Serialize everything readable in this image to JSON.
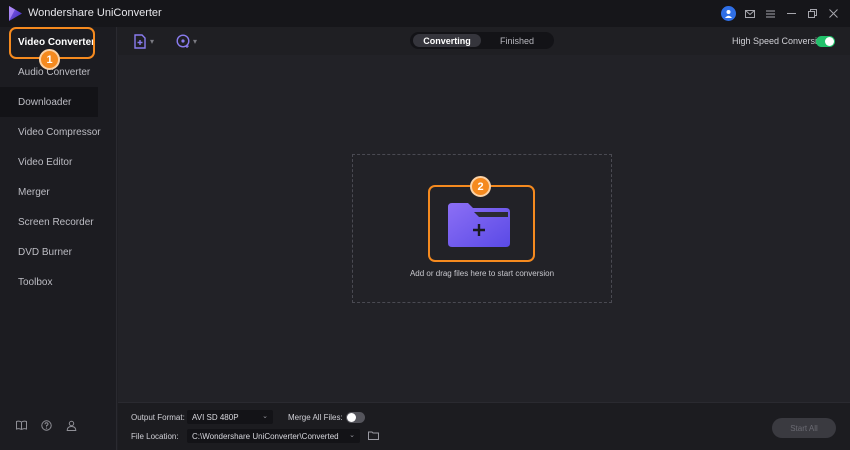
{
  "window": {
    "title": "Wondershare UniConverter"
  },
  "sidebar": {
    "items": [
      {
        "label": "Video Converter"
      },
      {
        "label": "Audio Converter"
      },
      {
        "label": "Downloader"
      },
      {
        "label": "Video Compressor"
      },
      {
        "label": "Video Editor"
      },
      {
        "label": "Merger"
      },
      {
        "label": "Screen Recorder"
      },
      {
        "label": "DVD Burner"
      },
      {
        "label": "Toolbox"
      }
    ],
    "bottom_icons": [
      "book-icon",
      "help-icon",
      "user-group-icon"
    ]
  },
  "annotations": {
    "step1": "1",
    "step2": "2"
  },
  "toolbar": {
    "add_files_icon": "add-file-icon",
    "add_dvd_icon": "add-disc-icon",
    "tabs": [
      {
        "label": "Converting",
        "active": true
      },
      {
        "label": "Finished",
        "active": false
      }
    ],
    "high_speed_label": "High Speed Conversion",
    "high_speed_on": true
  },
  "dropzone": {
    "text": "Add or drag files here to start conversion"
  },
  "bottombar": {
    "output_format_label": "Output Format:",
    "output_format_value": "AVI SD 480P",
    "merge_label": "Merge All Files:",
    "merge_on": false,
    "file_location_label": "File Location:",
    "file_location_value": "C:\\Wondershare UniConverter\\Converted",
    "start_all_label": "Start All"
  },
  "colors": {
    "accent": "#f58a1f",
    "toggle_on": "#23c16b",
    "folder": "#6f5cf2"
  }
}
